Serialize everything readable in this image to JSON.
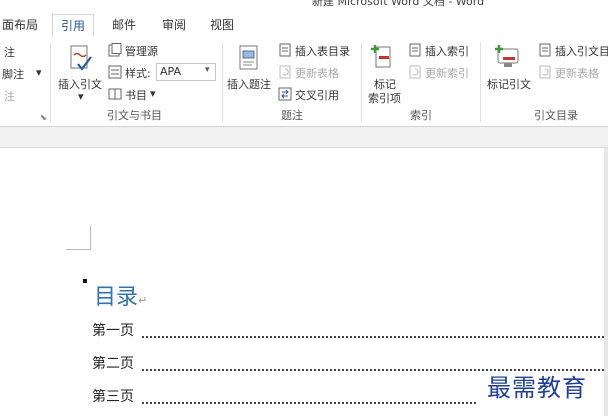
{
  "window": {
    "title": "新建 Microsoft Word 文档 - Word"
  },
  "tabs": [
    {
      "label": "面布局"
    },
    {
      "label": "引用"
    },
    {
      "label": "邮件"
    },
    {
      "label": "审阅"
    },
    {
      "label": "视图"
    }
  ],
  "ribbon": {
    "left_partial": {
      "item1": "注",
      "item2": "脚注",
      "item3": "注"
    },
    "citations": {
      "insert_citation": "插入引文",
      "manage_sources": "管理源",
      "style_label": "样式:",
      "style_value": "APA",
      "bibliography": "书目",
      "group": "引文与书目"
    },
    "captions": {
      "insert_caption": "插入题注",
      "insert_table_of_figures": "插入表目录",
      "update_table": "更新表格",
      "cross_reference": "交叉引用",
      "group": "题注"
    },
    "index": {
      "mark_entry_line1": "标记",
      "mark_entry_line2": "索引项",
      "insert_index": "插入索引",
      "update_index": "更新索引",
      "group": "索引"
    },
    "toa": {
      "mark_citation": "标记引文",
      "insert_toa": "插入引文目",
      "update_table": "更新表格",
      "group": "引文目录"
    }
  },
  "document": {
    "toc_title": "目录",
    "entries": [
      {
        "label": "第一页"
      },
      {
        "label": "第二页"
      },
      {
        "label": "第三页"
      }
    ]
  },
  "watermark": "最需教育"
}
